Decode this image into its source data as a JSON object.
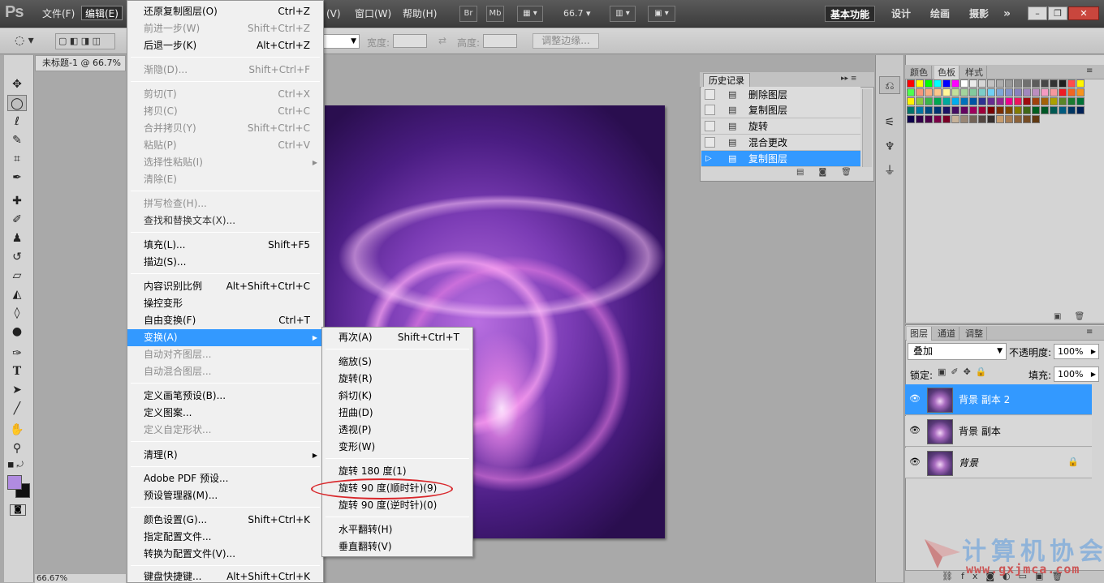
{
  "app": {
    "logo": "Ps"
  },
  "menubar": {
    "items": [
      "文件(F)",
      "编辑(E)",
      "(V)",
      "窗口(W)",
      "帮助(H)"
    ],
    "bridge": "Br",
    "minibridge": "Mb",
    "zoom": "66.7",
    "workspaces": [
      "基本功能",
      "设计",
      "绘画",
      "摄影"
    ],
    "more": "»"
  },
  "options": {
    "width_label": "宽度:",
    "height_label": "高度:",
    "refine_button": "调整边缘..."
  },
  "document": {
    "tab_title": "未标题-1 @ 66.7%",
    "status_zoom": "66.67%"
  },
  "edit_menu": {
    "items": [
      {
        "label": "还原复制图层(O)",
        "shortcut": "Ctrl+Z",
        "disabled": false
      },
      {
        "label": "前进一步(W)",
        "shortcut": "Shift+Ctrl+Z",
        "disabled": true
      },
      {
        "label": "后退一步(K)",
        "shortcut": "Alt+Ctrl+Z",
        "disabled": false
      },
      {
        "label": "渐隐(D)...",
        "shortcut": "Shift+Ctrl+F",
        "disabled": true
      },
      {
        "label": "剪切(T)",
        "shortcut": "Ctrl+X",
        "disabled": true
      },
      {
        "label": "拷贝(C)",
        "shortcut": "Ctrl+C",
        "disabled": true
      },
      {
        "label": "合并拷贝(Y)",
        "shortcut": "Shift+Ctrl+C",
        "disabled": true
      },
      {
        "label": "粘贴(P)",
        "shortcut": "Ctrl+V",
        "disabled": true
      },
      {
        "label": "选择性粘贴(I)",
        "shortcut": "",
        "disabled": true,
        "submenu": true
      },
      {
        "label": "清除(E)",
        "shortcut": "",
        "disabled": true
      },
      {
        "label": "拼写检查(H)...",
        "shortcut": "",
        "disabled": true
      },
      {
        "label": "查找和替换文本(X)...",
        "shortcut": "",
        "disabled": true
      },
      {
        "label": "填充(L)...",
        "shortcut": "Shift+F5",
        "disabled": false
      },
      {
        "label": "描边(S)...",
        "shortcut": "",
        "disabled": false
      },
      {
        "label": "内容识别比例",
        "shortcut": "Alt+Shift+Ctrl+C",
        "disabled": false
      },
      {
        "label": "操控变形",
        "shortcut": "",
        "disabled": false
      },
      {
        "label": "自由变换(F)",
        "shortcut": "Ctrl+T",
        "disabled": false
      },
      {
        "label": "变换(A)",
        "shortcut": "",
        "disabled": false,
        "submenu": true,
        "highlighted": true
      },
      {
        "label": "自动对齐图层...",
        "shortcut": "",
        "disabled": true
      },
      {
        "label": "自动混合图层...",
        "shortcut": "",
        "disabled": true
      },
      {
        "label": "定义画笔预设(B)...",
        "shortcut": "",
        "disabled": false
      },
      {
        "label": "定义图案...",
        "shortcut": "",
        "disabled": false
      },
      {
        "label": "定义自定形状...",
        "shortcut": "",
        "disabled": true
      },
      {
        "label": "清理(R)",
        "shortcut": "",
        "disabled": false,
        "submenu": true
      },
      {
        "label": "Adobe PDF 预设...",
        "shortcut": "",
        "disabled": false
      },
      {
        "label": "预设管理器(M)...",
        "shortcut": "",
        "disabled": false
      },
      {
        "label": "颜色设置(G)...",
        "shortcut": "Shift+Ctrl+K",
        "disabled": false
      },
      {
        "label": "指定配置文件...",
        "shortcut": "",
        "disabled": false
      },
      {
        "label": "转换为配置文件(V)...",
        "shortcut": "",
        "disabled": false
      },
      {
        "label": "键盘快捷键...",
        "shortcut": "Alt+Shift+Ctrl+K",
        "disabled": false
      }
    ]
  },
  "transform_submenu": {
    "items": [
      {
        "label": "再次(A)",
        "shortcut": "Shift+Ctrl+T"
      },
      {
        "label": "缩放(S)",
        "shortcut": ""
      },
      {
        "label": "旋转(R)",
        "shortcut": ""
      },
      {
        "label": "斜切(K)",
        "shortcut": ""
      },
      {
        "label": "扭曲(D)",
        "shortcut": ""
      },
      {
        "label": "透视(P)",
        "shortcut": ""
      },
      {
        "label": "变形(W)",
        "shortcut": ""
      },
      {
        "label": "旋转 180 度(1)",
        "shortcut": ""
      },
      {
        "label": "旋转 90 度(顺时针)(9)",
        "shortcut": "",
        "circled": true
      },
      {
        "label": "旋转 90 度(逆时针)(0)",
        "shortcut": ""
      },
      {
        "label": "水平翻转(H)",
        "shortcut": ""
      },
      {
        "label": "垂直翻转(V)",
        "shortcut": ""
      }
    ]
  },
  "history": {
    "tab": "历史记录",
    "items": [
      {
        "label": "删除图层",
        "selected": false
      },
      {
        "label": "复制图层",
        "selected": false
      },
      {
        "label": "旋转",
        "selected": false
      },
      {
        "label": "混合更改",
        "selected": false
      },
      {
        "label": "复制图层",
        "selected": true
      }
    ]
  },
  "swatches": {
    "tabs": [
      "颜色",
      "色板",
      "样式"
    ],
    "selected_tab": "色板",
    "colors": [
      "#ff0000",
      "#ffff00",
      "#00ff00",
      "#00ffff",
      "#0000ff",
      "#ff00ff",
      "#ffffff",
      "#ebebeb",
      "#d6d6d6",
      "#c2c2c2",
      "#adadad",
      "#999999",
      "#858585",
      "#707070",
      "#5c5c5c",
      "#474747",
      "#333333",
      "#1f1f1f",
      "#ff4d4d",
      "#fff700",
      "#4dff4d",
      "#f7977a",
      "#f9ad81",
      "#fdc68a",
      "#fff79a",
      "#c4df9b",
      "#a2d39c",
      "#82ca9d",
      "#7bcdc8",
      "#6ecff6",
      "#7ea7d8",
      "#8493ca",
      "#8882be",
      "#a187be",
      "#bc8dbf",
      "#f49ac2",
      "#f6989d",
      "#ed1c24",
      "#f26522",
      "#f7941d",
      "#fff200",
      "#8dc63f",
      "#39b54a",
      "#00a651",
      "#00a99d",
      "#00aeef",
      "#0072bc",
      "#0054a6",
      "#2e3192",
      "#662d91",
      "#92278f",
      "#ec008c",
      "#ed145b",
      "#9e0b0f",
      "#a0410d",
      "#a36209",
      "#aba000",
      "#598527",
      "#1a7b30",
      "#007236",
      "#00746b",
      "#0076a3",
      "#004b80",
      "#003471",
      "#1b1464",
      "#440e62",
      "#630460",
      "#9e005d",
      "#9e0039",
      "#790000",
      "#7b2e00",
      "#7d4900",
      "#827b00",
      "#406618",
      "#005e20",
      "#005826",
      "#005952",
      "#005b7f",
      "#003663",
      "#002157",
      "#0d004c",
      "#32004b",
      "#4b0049",
      "#7b0046",
      "#7a0026",
      "#c7b299",
      "#998675",
      "#736357",
      "#534741",
      "#362f2d",
      "#c69c6d",
      "#a67c52",
      "#8c6239",
      "#754c24",
      "#603913"
    ]
  },
  "layers": {
    "tabs": [
      "图层",
      "通道",
      "调整"
    ],
    "selected_tab": "图层",
    "blend_mode": "叠加",
    "opacity_label": "不透明度:",
    "opacity": "100%",
    "lock_label": "锁定:",
    "fill_label": "填充:",
    "fill": "100%",
    "items": [
      {
        "name": "背景 副本 2",
        "selected": true,
        "locked": false
      },
      {
        "name": "背景 副本",
        "selected": false,
        "locked": false
      },
      {
        "name": "背景",
        "selected": false,
        "locked": true
      }
    ]
  },
  "watermark": {
    "text": "计算机协会",
    "url": "www.gxjmca.com"
  }
}
